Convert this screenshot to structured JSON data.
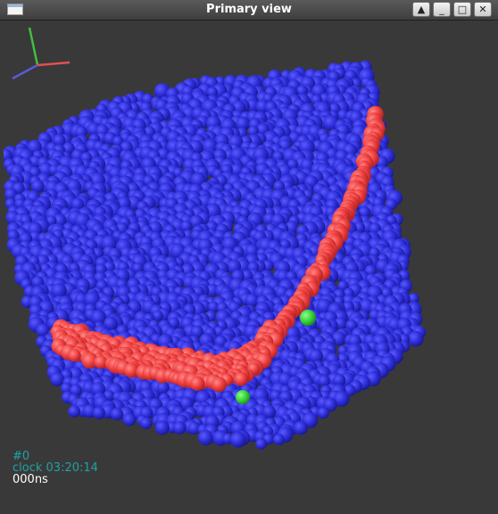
{
  "window": {
    "title": "Primary view",
    "buttons": {
      "up": "▲",
      "minimize": "_",
      "maximize": "□",
      "close": "✕"
    }
  },
  "hud": {
    "frame": "#0",
    "clock": "clock 03:20:14",
    "time": "000ns"
  },
  "colors": {
    "background": "#393939",
    "blue_atoms": "#2b2bd6",
    "red_atoms": "#f04040",
    "green_atoms": "#2ecc2e",
    "hud_teal": "#1fa3a3",
    "hud_white": "#ffffff",
    "axis_x": "#e05050",
    "axis_y": "#3fbf3f",
    "axis_z": "#5a5ad8"
  }
}
